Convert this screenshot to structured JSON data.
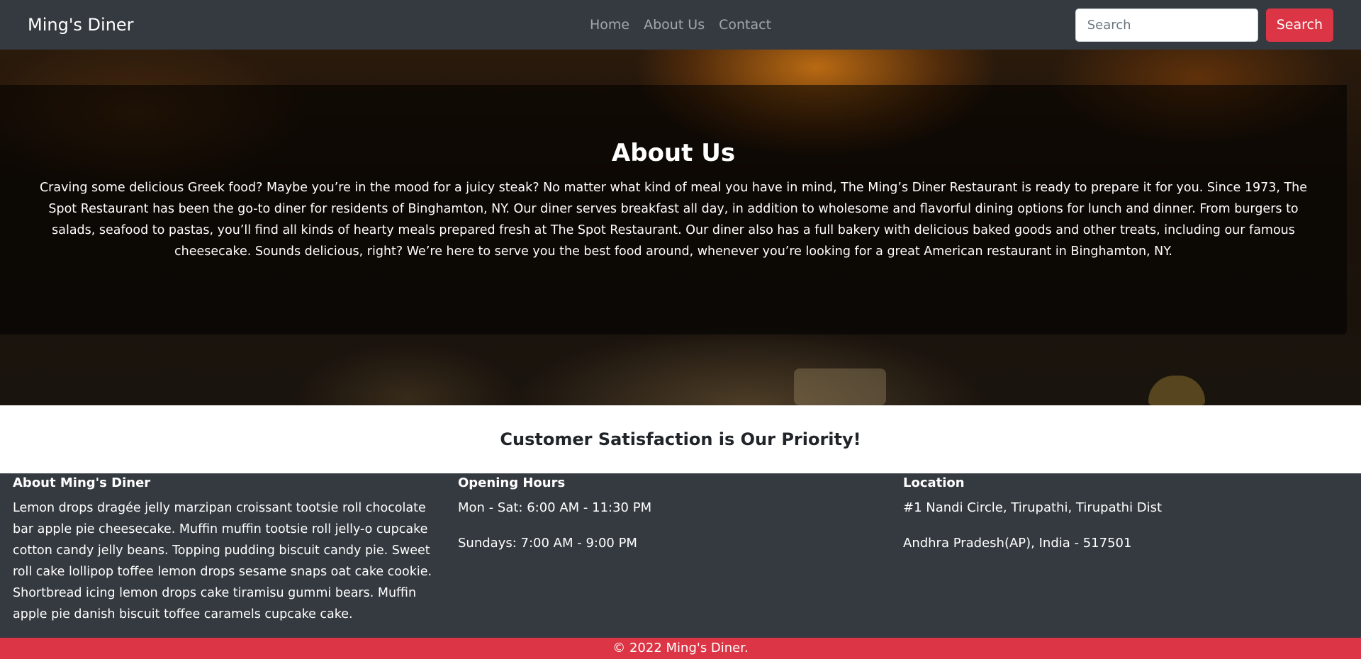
{
  "navbar": {
    "brand": "Ming's Diner",
    "links": [
      "Home",
      "About Us",
      "Contact"
    ],
    "search_placeholder": "Search",
    "search_button": "Search"
  },
  "hero": {
    "title": "About Us",
    "text": "Craving some delicious Greek food? Maybe you’re in the mood for a juicy steak? No matter what kind of meal you have in mind, The Ming’s Diner Restaurant is ready to prepare it for you. Since 1973, The Spot Restaurant has been the go-to diner for residents of Binghamton, NY. Our diner serves breakfast all day, in addition to wholesome and flavorful dining options for lunch and dinner. From burgers to salads, seafood to pastas, you’ll find all kinds of hearty meals prepared fresh at The Spot Restaurant. Our diner also has a full bakery with delicious baked goods and other treats, including our famous cheesecake. Sounds delicious, right? We’re here to serve you the best food around, whenever you’re looking for a great American restaurant in Binghamton, NY."
  },
  "tagline": "Customer Satisfaction is Our Priority!",
  "footer": {
    "about": {
      "heading": "About Ming's Diner",
      "text": "Lemon drops dragée jelly marzipan croissant tootsie roll chocolate bar apple pie cheesecake. Muffin muffin tootsie roll jelly-o cupcake cotton candy jelly beans. Topping pudding biscuit candy pie. Sweet roll cake lollipop toffee lemon drops sesame snaps oat cake cookie. Shortbread icing lemon drops cake tiramisu gummi bears. Muffin apple pie danish biscuit toffee caramels cupcake cake."
    },
    "hours": {
      "heading": "Opening Hours",
      "lines": [
        "Mon - Sat: 6:00 AM - 11:30 PM",
        "Sundays: 7:00 AM - 9:00 PM"
      ]
    },
    "location": {
      "heading": "Location",
      "lines": [
        "#1 Nandi Circle, Tirupathi, Tirupathi Dist",
        "Andhra Pradesh(AP), India - 517501"
      ]
    }
  },
  "copyright": "© 2022 Ming's Diner.",
  "colors": {
    "navbar_bg": "#343a40",
    "accent_red": "#dc3545",
    "footer_bg": "#343a40"
  }
}
